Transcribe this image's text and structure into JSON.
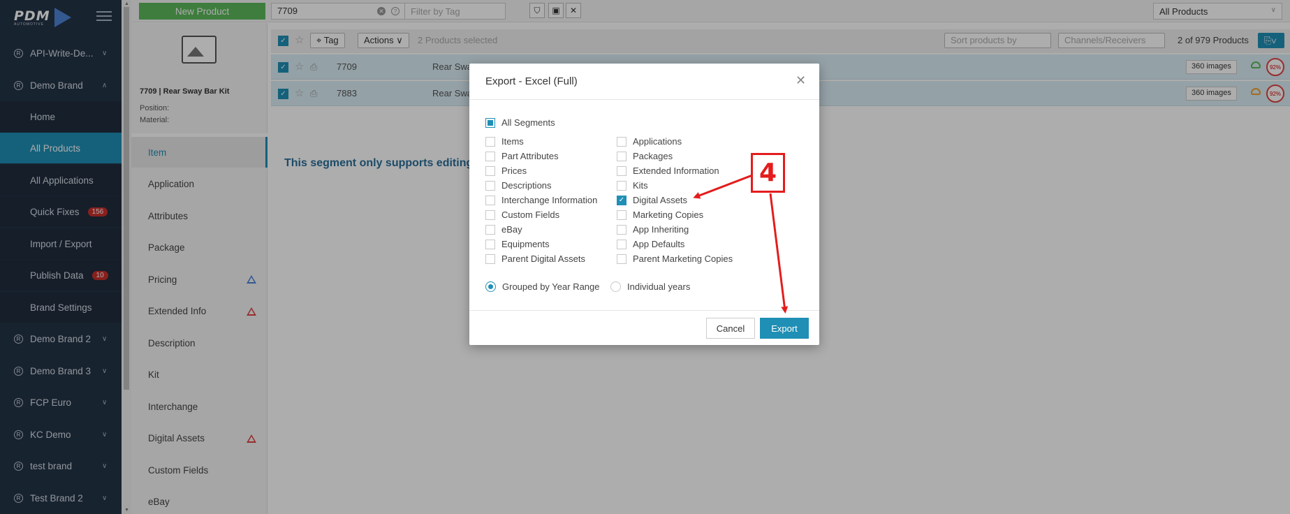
{
  "sidebar": {
    "logo": "PDM",
    "logo_sub": "AUTOMOTIVE",
    "items": [
      {
        "label": "API-Write-De...",
        "type": "brand"
      },
      {
        "label": "Demo Brand",
        "type": "brand"
      },
      {
        "label": "Home",
        "type": "sub"
      },
      {
        "label": "All Products",
        "type": "sub"
      },
      {
        "label": "All Applications",
        "type": "sub"
      },
      {
        "label": "Quick Fixes",
        "type": "sub",
        "badge": "156"
      },
      {
        "label": "Import / Export",
        "type": "sub"
      },
      {
        "label": "Publish Data",
        "type": "sub",
        "badge": "10"
      },
      {
        "label": "Brand Settings",
        "type": "sub"
      },
      {
        "label": "Demo Brand 2",
        "type": "brand"
      },
      {
        "label": "Demo Brand 3",
        "type": "brand"
      },
      {
        "label": "FCP Euro",
        "type": "brand"
      },
      {
        "label": "KC Demo",
        "type": "brand"
      },
      {
        "label": "test brand",
        "type": "brand"
      },
      {
        "label": "Test Brand 2",
        "type": "brand"
      }
    ]
  },
  "topbar": {
    "new_product": "New Product",
    "search_value": "7709",
    "tag_placeholder": "Filter by Tag",
    "view_select": "All Products"
  },
  "product": {
    "title": "7709 | Rear Sway Bar Kit",
    "position_label": "Position:",
    "material_label": "Material:"
  },
  "segments": [
    {
      "label": "Item",
      "active": true
    },
    {
      "label": "Application"
    },
    {
      "label": "Attributes"
    },
    {
      "label": "Package"
    },
    {
      "label": "Pricing",
      "warn": "blue"
    },
    {
      "label": "Extended Info",
      "warn": "red"
    },
    {
      "label": "Description"
    },
    {
      "label": "Kit"
    },
    {
      "label": "Interchange"
    },
    {
      "label": "Digital Assets",
      "warn": "red"
    },
    {
      "label": "Custom Fields"
    },
    {
      "label": "eBay"
    }
  ],
  "list": {
    "tag_label": "Tag",
    "actions_label": "Actions",
    "selected_text": "2 Products selected",
    "sort_label": "Sort products by",
    "channels_label": "Channels/Receivers",
    "count_text": "2 of 979 Products",
    "rows": [
      {
        "part": "7709",
        "desc": "Rear Swa",
        "images": "360 images",
        "pct": "92%",
        "cloud": "green"
      },
      {
        "part": "7883",
        "desc": "Rear Swa",
        "images": "360 images",
        "pct": "92%",
        "cloud": "orange"
      }
    ],
    "segment_message": "This segment only supports editing"
  },
  "modal": {
    "title": "Export - Excel (Full)",
    "all_segments": "All Segments",
    "left_options": [
      {
        "label": "Items",
        "checked": false
      },
      {
        "label": "Part Attributes",
        "checked": false
      },
      {
        "label": "Prices",
        "checked": false
      },
      {
        "label": "Descriptions",
        "checked": false
      },
      {
        "label": "Interchange Information",
        "checked": false
      },
      {
        "label": "Custom Fields",
        "checked": false
      },
      {
        "label": "eBay",
        "checked": false
      },
      {
        "label": "Equipments",
        "checked": false
      },
      {
        "label": "Parent Digital Assets",
        "checked": false
      }
    ],
    "right_options": [
      {
        "label": "Applications",
        "checked": false
      },
      {
        "label": "Packages",
        "checked": false
      },
      {
        "label": "Extended Information",
        "checked": false
      },
      {
        "label": "Kits",
        "checked": false
      },
      {
        "label": "Digital Assets",
        "checked": true
      },
      {
        "label": "Marketing Copies",
        "checked": false
      },
      {
        "label": "App Inheriting",
        "checked": false
      },
      {
        "label": "App Defaults",
        "checked": false
      },
      {
        "label": "Parent Marketing Copies",
        "checked": false
      }
    ],
    "radio_grouped": "Grouped by Year Range",
    "radio_individual": "Individual years",
    "cancel": "Cancel",
    "export": "Export"
  },
  "annotation": {
    "step_number": "4",
    "color": "#e41c1c"
  }
}
